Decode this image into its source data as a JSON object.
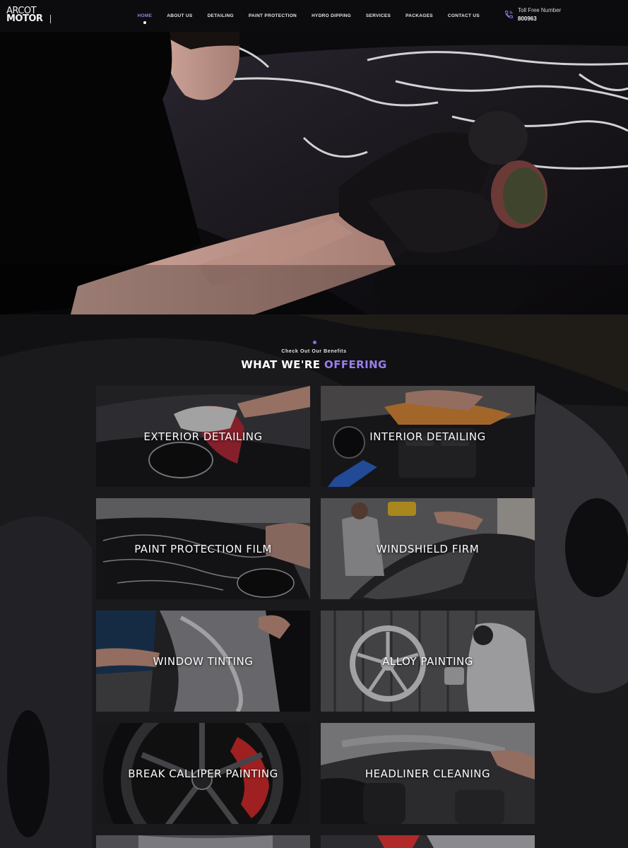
{
  "brand": {
    "logo_line1": "ARCOT",
    "logo_line2": "MOTOR"
  },
  "nav": {
    "items": [
      "HOME",
      "ABOUT US",
      "DETAILING",
      "PAINT PROTECTION",
      "HYDRO DIPPING",
      "SERVICES",
      "PACKAGES",
      "CONTACT US"
    ],
    "active": "HOME"
  },
  "contact": {
    "label": "Toll Free Number",
    "number": "800963",
    "icon": "phone-icon"
  },
  "offering": {
    "subtitle": "Check Out Our Benefits",
    "title_plain": "WHAT WE'RE",
    "title_accent": "OFFERING",
    "cards": [
      "EXTERIOR DETAILING",
      "INTERIOR DETAILING",
      "PAINT PROTECTION FILM",
      "WINDSHIELD FIRM",
      "WINDOW TINTING",
      "ALLOY PAINTING",
      "BREAK CALLIPER PAINTING",
      "HEADLINER CLEANING"
    ]
  },
  "colors": {
    "accent": "#9a7df0",
    "header_bg": "#0c0c0e",
    "page_bg": "#0b0b0d"
  }
}
